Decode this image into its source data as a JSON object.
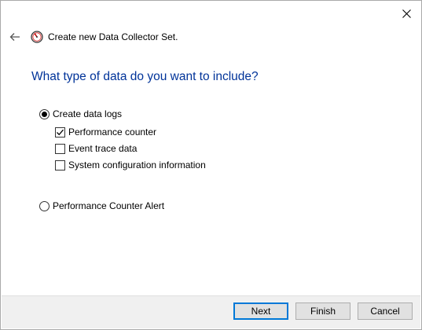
{
  "dialog": {
    "title": "Create new Data Collector Set.",
    "heading": "What type of data do you want to include?"
  },
  "options": {
    "create_logs": {
      "label": "Create data logs",
      "selected": true
    },
    "performance_counter": {
      "label": "Performance counter",
      "checked": true
    },
    "event_trace": {
      "label": "Event trace data",
      "checked": false
    },
    "system_config": {
      "label": "System configuration information",
      "checked": false
    },
    "counter_alert": {
      "label": "Performance Counter Alert",
      "selected": false
    }
  },
  "buttons": {
    "next": "Next",
    "finish": "Finish",
    "cancel": "Cancel"
  },
  "colors": {
    "heading": "#003399",
    "default_button_border": "#0078d7",
    "footer_bg": "#f0f0f0"
  }
}
